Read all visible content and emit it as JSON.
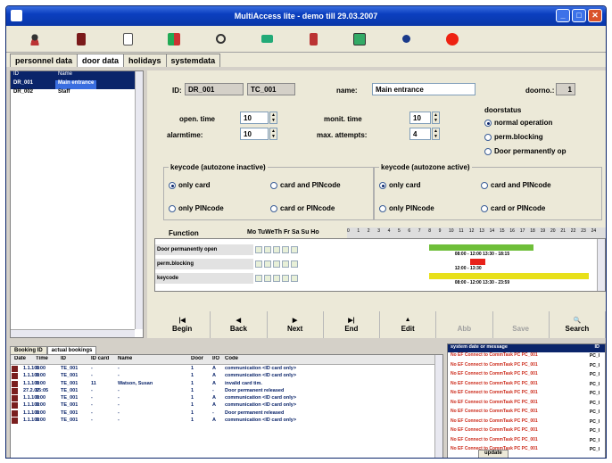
{
  "window": {
    "title": "MultiAccess lite - demo till 29.03.2007"
  },
  "toolbar": {
    "icons": [
      "person-icon",
      "book-icon",
      "document-icon",
      "door-users-icon",
      "key-search-icon",
      "comment-icon",
      "door-icon",
      "calculator-icon",
      "circle-icon",
      "stop-icon"
    ]
  },
  "tabs": [
    "personnel data",
    "door data",
    "holidays",
    "systemdata"
  ],
  "door_list": {
    "headers": [
      "ID",
      "Name"
    ],
    "rows": [
      {
        "id": "DR_001",
        "name": "Main entrance"
      },
      {
        "id": "DR_002",
        "name": "Staff"
      }
    ]
  },
  "door_form": {
    "id_label": "ID:",
    "id_value": "DR_001",
    "tc_value": "TC_001",
    "name_label": "name:",
    "name_value": "Main entrance",
    "doorno_label": "doorno.:",
    "doorno_value": "1",
    "open_time_label": "open. time",
    "open_time_value": "10",
    "alarmtime_label": "alarmtime:",
    "alarmtime_value": "10",
    "monit_time_label": "monit. time",
    "monit_time_value": "10",
    "max_attempts_label": "max. attempts:",
    "max_attempts_value": "4",
    "doorstatus_label": "doorstatus",
    "doorstatus_options": [
      "normal operation",
      "perm.blocking",
      "Door permanently op"
    ],
    "keycode_inactive_label": "keycode (autozone inactive)",
    "keycode_active_label": "keycode (autozone active)",
    "keycode_options": [
      "only card",
      "card and PINcode",
      "only PINcode",
      "card or PINcode"
    ]
  },
  "schedule": {
    "function_label": "Function",
    "days": "Mo TuWeTh Fr Sa Su Ho",
    "hours": [
      "0",
      "1",
      "2",
      "3",
      "4",
      "5",
      "6",
      "7",
      "8",
      "9",
      "10",
      "11",
      "12",
      "13",
      "14",
      "15",
      "16",
      "17",
      "18",
      "19",
      "20",
      "21",
      "22",
      "23",
      "24"
    ],
    "rows": [
      {
        "name": "Door permanently open",
        "times": "08:00 - 12:00  13:30 - 18:15",
        "color": "#6fbf3a"
      },
      {
        "name": "perm.blocking",
        "times": "12:00 - 13:30",
        "color": "#e8221a"
      },
      {
        "name": "keycode",
        "times": "08:00 - 12:00  13:30 - 23:59",
        "color": "#e8e01a"
      }
    ]
  },
  "nav": [
    {
      "glyph": "|◀",
      "label": "Begin"
    },
    {
      "glyph": "◀",
      "label": "Back"
    },
    {
      "glyph": "▶",
      "label": "Next"
    },
    {
      "glyph": "▶|",
      "label": "End"
    },
    {
      "glyph": "▲",
      "label": "Edit"
    },
    {
      "glyph": "",
      "label": "Abb"
    },
    {
      "glyph": "",
      "label": "Save"
    },
    {
      "glyph": "🔍",
      "label": "Search"
    }
  ],
  "bookings": {
    "tabs": [
      "Booking ID",
      "actual bookings"
    ],
    "headers": [
      "Date",
      "Time",
      "ID",
      "ID card",
      "Name",
      "Door",
      "I/O",
      "Code"
    ],
    "rows": [
      {
        "date": "1.1.100",
        "time": "0:00",
        "id": "TE_001",
        "card": "-",
        "name": "-",
        "door": "1",
        "io": "A",
        "code": "communication <ID card only>"
      },
      {
        "date": "1.1.100",
        "time": "0:00",
        "id": "TE_001",
        "card": "-",
        "name": "-",
        "door": "1",
        "io": "A",
        "code": "communication <ID card only>"
      },
      {
        "date": "1.1.100",
        "time": "0:00",
        "id": "TE_001",
        "card": "11",
        "name": "Watson, Susan",
        "door": "1",
        "io": "A",
        "code": "invalid card tim."
      },
      {
        "date": "27.2.07",
        "time": "15:05",
        "id": "TE_001",
        "card": "-",
        "name": "-",
        "door": "1",
        "io": "-",
        "code": "Door permanent released"
      },
      {
        "date": "1.1.100",
        "time": "0:00",
        "id": "TE_001",
        "card": "-",
        "name": "-",
        "door": "1",
        "io": "A",
        "code": "communication <ID card only>"
      },
      {
        "date": "1.1.100",
        "time": "0:00",
        "id": "TE_001",
        "card": "-",
        "name": "-",
        "door": "1",
        "io": "A",
        "code": "communication <ID card only>"
      },
      {
        "date": "1.1.100",
        "time": "0:00",
        "id": "TE_001",
        "card": "-",
        "name": "-",
        "door": "1",
        "io": "-",
        "code": "Door permanent released"
      },
      {
        "date": "1.1.100",
        "time": "0:00",
        "id": "TE_001",
        "card": "-",
        "name": "-",
        "door": "1",
        "io": "A",
        "code": "communication <ID card only>"
      }
    ]
  },
  "system_messages": {
    "header": "system date or message",
    "header_id": "ID",
    "items": [
      "No EF Connect to CommTask PC PC_001",
      "No EF Connect to CommTask PC PC_001",
      "No EF Connect to CommTask PC PC_001",
      "No EF Connect to CommTask PC PC_001",
      "No EF Connect to CommTask PC PC_001",
      "No EF Connect to CommTask PC PC_001",
      "No EF Connect to CommTask PC PC_001",
      "No EF Connect to CommTask PC PC_001",
      "No EF Connect to CommTask PC PC_001",
      "No EF Connect to CommTask PC PC_001",
      "No EF Connect to CommTask PC PC_001"
    ],
    "item_id": "PC_I",
    "update_label": "update"
  }
}
